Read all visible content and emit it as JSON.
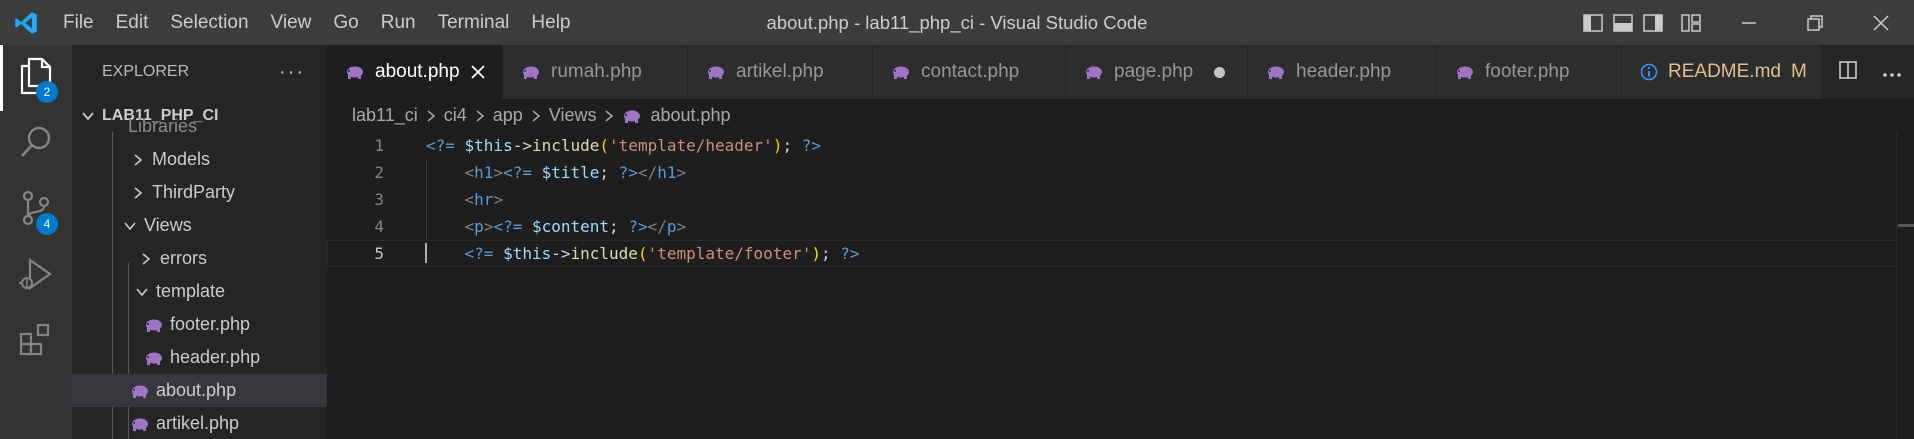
{
  "window_title": "about.php - lab11_php_ci - Visual Studio Code",
  "menu": [
    "File",
    "Edit",
    "Selection",
    "View",
    "Go",
    "Run",
    "Terminal",
    "Help"
  ],
  "activity": {
    "explorer_badge": "2",
    "scm_badge": "4"
  },
  "sidebar": {
    "header": "EXPLORER",
    "more": "···",
    "section": "LAB11_PHP_CI",
    "items": [
      {
        "label": "Libraries"
      },
      {
        "label": "Models"
      },
      {
        "label": "ThirdParty"
      },
      {
        "label": "Views"
      },
      {
        "label": "errors"
      },
      {
        "label": "template"
      },
      {
        "label": "footer.php"
      },
      {
        "label": "header.php"
      },
      {
        "label": "about.php"
      },
      {
        "label": "artikel.php"
      }
    ]
  },
  "tabs": [
    {
      "label": "about.php"
    },
    {
      "label": "rumah.php"
    },
    {
      "label": "artikel.php"
    },
    {
      "label": "contact.php"
    },
    {
      "label": "page.php"
    },
    {
      "label": "header.php"
    },
    {
      "label": "footer.php"
    },
    {
      "label": "README.md",
      "status": "M"
    }
  ],
  "breadcrumb": [
    "lab11_ci",
    "ci4",
    "app",
    "Views",
    "about.php"
  ],
  "code": {
    "line_numbers": [
      "1",
      "2",
      "3",
      "4",
      "5"
    ],
    "lines": [
      [
        {
          "t": "tag",
          "v": "<?= "
        },
        {
          "t": "var",
          "v": "$this"
        },
        {
          "t": "op",
          "v": "->"
        },
        {
          "t": "fn",
          "v": "include"
        },
        {
          "t": "paren",
          "v": "("
        },
        {
          "t": "str",
          "v": "'template/header'"
        },
        {
          "t": "paren",
          "v": ")"
        },
        {
          "t": "op",
          "v": "; "
        },
        {
          "t": "tag",
          "v": "?>"
        }
      ],
      [
        {
          "t": "op",
          "v": "    "
        },
        {
          "t": "html",
          "v": "<"
        },
        {
          "t": "htmltag",
          "v": "h1"
        },
        {
          "t": "html",
          "v": ">"
        },
        {
          "t": "tag",
          "v": "<?= "
        },
        {
          "t": "var",
          "v": "$title"
        },
        {
          "t": "op",
          "v": "; "
        },
        {
          "t": "tag",
          "v": "?>"
        },
        {
          "t": "html",
          "v": "</"
        },
        {
          "t": "htmltag",
          "v": "h1"
        },
        {
          "t": "html",
          "v": ">"
        }
      ],
      [
        {
          "t": "op",
          "v": "    "
        },
        {
          "t": "html",
          "v": "<"
        },
        {
          "t": "htmltag",
          "v": "hr"
        },
        {
          "t": "html",
          "v": ">"
        }
      ],
      [
        {
          "t": "op",
          "v": "    "
        },
        {
          "t": "html",
          "v": "<"
        },
        {
          "t": "htmltag",
          "v": "p"
        },
        {
          "t": "html",
          "v": ">"
        },
        {
          "t": "tag",
          "v": "<?= "
        },
        {
          "t": "var",
          "v": "$content"
        },
        {
          "t": "op",
          "v": "; "
        },
        {
          "t": "tag",
          "v": "?>"
        },
        {
          "t": "html",
          "v": "</"
        },
        {
          "t": "htmltag",
          "v": "p"
        },
        {
          "t": "html",
          "v": ">"
        }
      ],
      [
        {
          "t": "op",
          "v": "    "
        },
        {
          "t": "tag",
          "v": "<?= "
        },
        {
          "t": "var",
          "v": "$this"
        },
        {
          "t": "op",
          "v": "->"
        },
        {
          "t": "fn",
          "v": "include"
        },
        {
          "t": "paren",
          "v": "("
        },
        {
          "t": "str",
          "v": "'template/footer'"
        },
        {
          "t": "paren",
          "v": ")"
        },
        {
          "t": "op",
          "v": "; "
        },
        {
          "t": "tag",
          "v": "?>"
        }
      ]
    ]
  },
  "colors": {
    "accent": "#007acc",
    "php_icon": "#a074c4",
    "modified": "#e2c08d",
    "info": "#3794ff"
  }
}
